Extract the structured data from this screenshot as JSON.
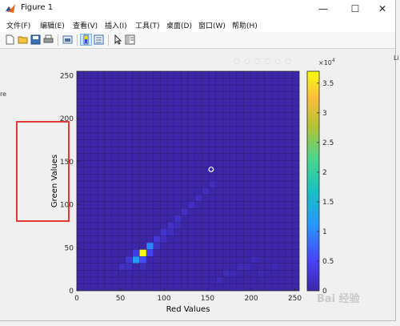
{
  "window": {
    "title": "Figure 1",
    "minimize": "—",
    "maximize": "☐",
    "close": "✕"
  },
  "menu": [
    "文件(F)",
    "编辑(E)",
    "查看(V)",
    "插入(I)",
    "工具(T)",
    "桌面(D)",
    "窗口(W)",
    "帮助(H)"
  ],
  "toolbar": {
    "icons": [
      "new-file-icon",
      "open-file-icon",
      "save-icon",
      "print-icon",
      "link-plot-icon",
      "colorbar-toggle-icon",
      "legend-toggle-icon",
      "pointer-icon",
      "property-inspector-icon"
    ]
  },
  "edge_fragments": {
    "left": "re",
    "right": "Li"
  },
  "chart_data": {
    "type": "heatmap",
    "title": "",
    "xlabel": "Red Values",
    "ylabel": "Green Values",
    "xlim": [
      0,
      255
    ],
    "ylim": [
      0,
      255
    ],
    "xticks": [
      "0",
      "50",
      "100",
      "150",
      "200",
      "250"
    ],
    "yticks": [
      "0",
      "50",
      "100",
      "150",
      "200",
      "250"
    ],
    "grid_bins": 32,
    "colormap": [
      "#3e26a8",
      "#4743f8",
      "#2797ff",
      "#18c0c3",
      "#49d68c",
      "#b4c332",
      "#fdbd3c",
      "#f9fb0e"
    ],
    "colorbar": {
      "ticks": [
        "0",
        "0.5",
        "1",
        "1.5",
        "2",
        "2.5",
        "3",
        "3.5"
      ],
      "exponent_label": "×10",
      "exponent": "4",
      "max": 37000
    },
    "cells": [
      {
        "red": 72,
        "green": 40,
        "value": 37000
      },
      {
        "red": 64,
        "green": 32,
        "value": 11000
      },
      {
        "red": 72,
        "green": 32,
        "value": 6000
      },
      {
        "red": 80,
        "green": 48,
        "value": 9500
      },
      {
        "red": 80,
        "green": 40,
        "value": 5000
      },
      {
        "red": 64,
        "green": 40,
        "value": 4000
      },
      {
        "red": 56,
        "green": 32,
        "value": 3000
      },
      {
        "red": 48,
        "green": 24,
        "value": 2000
      },
      {
        "red": 88,
        "green": 56,
        "value": 3000
      },
      {
        "red": 96,
        "green": 64,
        "value": 2500
      },
      {
        "red": 104,
        "green": 72,
        "value": 2000
      },
      {
        "red": 112,
        "green": 80,
        "value": 2000
      },
      {
        "red": 120,
        "green": 88,
        "value": 1800
      },
      {
        "red": 128,
        "green": 96,
        "value": 1800
      },
      {
        "red": 136,
        "green": 104,
        "value": 1700
      },
      {
        "red": 144,
        "green": 112,
        "value": 1500
      },
      {
        "red": 152,
        "green": 120,
        "value": 1400
      },
      {
        "red": 88,
        "green": 48,
        "value": 1800
      },
      {
        "red": 96,
        "green": 56,
        "value": 1500
      },
      {
        "red": 104,
        "green": 64,
        "value": 1400
      },
      {
        "red": 112,
        "green": 72,
        "value": 1300
      },
      {
        "red": 56,
        "green": 24,
        "value": 1600
      },
      {
        "red": 72,
        "green": 24,
        "value": 1200
      },
      {
        "red": 168,
        "green": 16,
        "value": 1200
      },
      {
        "red": 176,
        "green": 16,
        "value": 1000
      },
      {
        "red": 184,
        "green": 24,
        "value": 1000
      },
      {
        "red": 160,
        "green": 8,
        "value": 900
      },
      {
        "red": 192,
        "green": 24,
        "value": 900
      },
      {
        "red": 200,
        "green": 32,
        "value": 900
      },
      {
        "red": 208,
        "green": 16,
        "value": 800
      },
      {
        "red": 224,
        "green": 24,
        "value": 800
      }
    ],
    "marker": {
      "red": 154,
      "green": 141
    }
  }
}
